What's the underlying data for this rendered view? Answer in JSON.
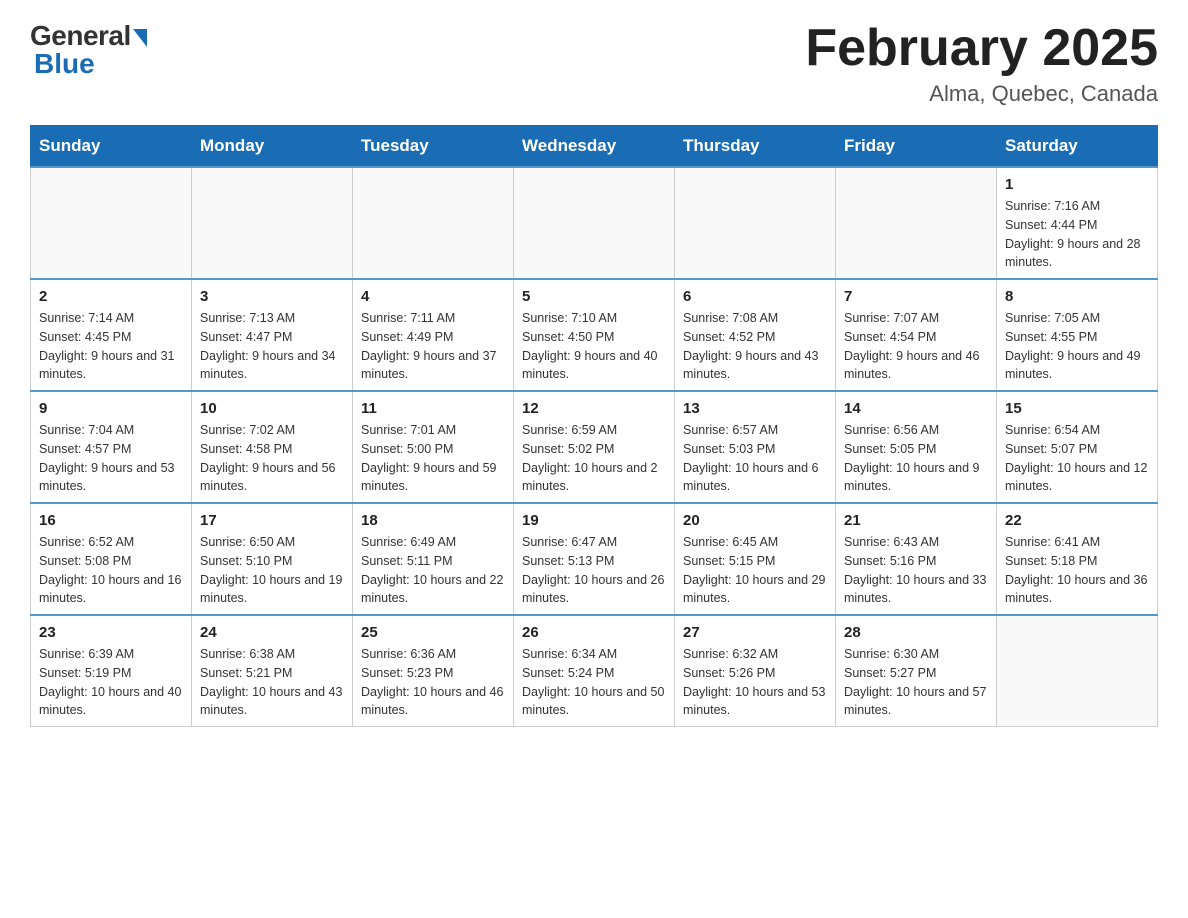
{
  "header": {
    "logo_general": "General",
    "logo_blue": "Blue",
    "month_title": "February 2025",
    "location": "Alma, Quebec, Canada"
  },
  "days_of_week": [
    "Sunday",
    "Monday",
    "Tuesday",
    "Wednesday",
    "Thursday",
    "Friday",
    "Saturday"
  ],
  "weeks": [
    [
      {
        "day": "",
        "info": ""
      },
      {
        "day": "",
        "info": ""
      },
      {
        "day": "",
        "info": ""
      },
      {
        "day": "",
        "info": ""
      },
      {
        "day": "",
        "info": ""
      },
      {
        "day": "",
        "info": ""
      },
      {
        "day": "1",
        "info": "Sunrise: 7:16 AM\nSunset: 4:44 PM\nDaylight: 9 hours and 28 minutes."
      }
    ],
    [
      {
        "day": "2",
        "info": "Sunrise: 7:14 AM\nSunset: 4:45 PM\nDaylight: 9 hours and 31 minutes."
      },
      {
        "day": "3",
        "info": "Sunrise: 7:13 AM\nSunset: 4:47 PM\nDaylight: 9 hours and 34 minutes."
      },
      {
        "day": "4",
        "info": "Sunrise: 7:11 AM\nSunset: 4:49 PM\nDaylight: 9 hours and 37 minutes."
      },
      {
        "day": "5",
        "info": "Sunrise: 7:10 AM\nSunset: 4:50 PM\nDaylight: 9 hours and 40 minutes."
      },
      {
        "day": "6",
        "info": "Sunrise: 7:08 AM\nSunset: 4:52 PM\nDaylight: 9 hours and 43 minutes."
      },
      {
        "day": "7",
        "info": "Sunrise: 7:07 AM\nSunset: 4:54 PM\nDaylight: 9 hours and 46 minutes."
      },
      {
        "day": "8",
        "info": "Sunrise: 7:05 AM\nSunset: 4:55 PM\nDaylight: 9 hours and 49 minutes."
      }
    ],
    [
      {
        "day": "9",
        "info": "Sunrise: 7:04 AM\nSunset: 4:57 PM\nDaylight: 9 hours and 53 minutes."
      },
      {
        "day": "10",
        "info": "Sunrise: 7:02 AM\nSunset: 4:58 PM\nDaylight: 9 hours and 56 minutes."
      },
      {
        "day": "11",
        "info": "Sunrise: 7:01 AM\nSunset: 5:00 PM\nDaylight: 9 hours and 59 minutes."
      },
      {
        "day": "12",
        "info": "Sunrise: 6:59 AM\nSunset: 5:02 PM\nDaylight: 10 hours and 2 minutes."
      },
      {
        "day": "13",
        "info": "Sunrise: 6:57 AM\nSunset: 5:03 PM\nDaylight: 10 hours and 6 minutes."
      },
      {
        "day": "14",
        "info": "Sunrise: 6:56 AM\nSunset: 5:05 PM\nDaylight: 10 hours and 9 minutes."
      },
      {
        "day": "15",
        "info": "Sunrise: 6:54 AM\nSunset: 5:07 PM\nDaylight: 10 hours and 12 minutes."
      }
    ],
    [
      {
        "day": "16",
        "info": "Sunrise: 6:52 AM\nSunset: 5:08 PM\nDaylight: 10 hours and 16 minutes."
      },
      {
        "day": "17",
        "info": "Sunrise: 6:50 AM\nSunset: 5:10 PM\nDaylight: 10 hours and 19 minutes."
      },
      {
        "day": "18",
        "info": "Sunrise: 6:49 AM\nSunset: 5:11 PM\nDaylight: 10 hours and 22 minutes."
      },
      {
        "day": "19",
        "info": "Sunrise: 6:47 AM\nSunset: 5:13 PM\nDaylight: 10 hours and 26 minutes."
      },
      {
        "day": "20",
        "info": "Sunrise: 6:45 AM\nSunset: 5:15 PM\nDaylight: 10 hours and 29 minutes."
      },
      {
        "day": "21",
        "info": "Sunrise: 6:43 AM\nSunset: 5:16 PM\nDaylight: 10 hours and 33 minutes."
      },
      {
        "day": "22",
        "info": "Sunrise: 6:41 AM\nSunset: 5:18 PM\nDaylight: 10 hours and 36 minutes."
      }
    ],
    [
      {
        "day": "23",
        "info": "Sunrise: 6:39 AM\nSunset: 5:19 PM\nDaylight: 10 hours and 40 minutes."
      },
      {
        "day": "24",
        "info": "Sunrise: 6:38 AM\nSunset: 5:21 PM\nDaylight: 10 hours and 43 minutes."
      },
      {
        "day": "25",
        "info": "Sunrise: 6:36 AM\nSunset: 5:23 PM\nDaylight: 10 hours and 46 minutes."
      },
      {
        "day": "26",
        "info": "Sunrise: 6:34 AM\nSunset: 5:24 PM\nDaylight: 10 hours and 50 minutes."
      },
      {
        "day": "27",
        "info": "Sunrise: 6:32 AM\nSunset: 5:26 PM\nDaylight: 10 hours and 53 minutes."
      },
      {
        "day": "28",
        "info": "Sunrise: 6:30 AM\nSunset: 5:27 PM\nDaylight: 10 hours and 57 minutes."
      },
      {
        "day": "",
        "info": ""
      }
    ]
  ]
}
